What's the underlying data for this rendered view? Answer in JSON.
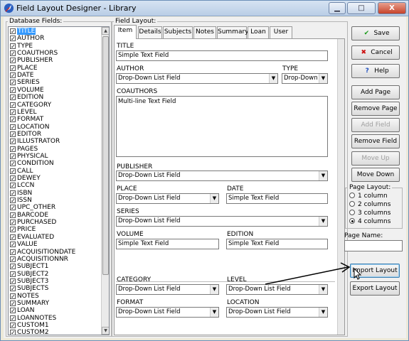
{
  "window": {
    "title": "Field Layout Designer - Library",
    "min_label": "▁",
    "max_label": "□",
    "close_label": "X"
  },
  "db_fields": {
    "label": "Database Fields:",
    "items": [
      "TITLE",
      "AUTHOR",
      "TYPE",
      "COAUTHORS",
      "PUBLISHER",
      "PLACE",
      "DATE",
      "SERIES",
      "VOLUME",
      "EDITION",
      "CATEGORY",
      "LEVEL",
      "FORMAT",
      "LOCATION",
      "EDITOR",
      "ILLUSTRATOR",
      "PAGES",
      "PHYSICAL",
      "CONDITION",
      "CALL",
      "DEWEY",
      "LCCN",
      "ISBN",
      "ISSN",
      "UPC_OTHER",
      "BARCODE",
      "PURCHASED",
      "PRICE",
      "EVALUATED",
      "VALUE",
      "ACQUISITIONDATE",
      "ACQUISITIONNR",
      "SUBJECT1",
      "SUBJECT2",
      "SUBJECT3",
      "SUBJECTS",
      "NOTES",
      "SUMMARY",
      "LOAN",
      "LOANNOTES",
      "CUSTOM1",
      "CUSTOM2"
    ],
    "selected": "TITLE",
    "check": "✓"
  },
  "layout": {
    "label": "Field Layout:",
    "tabs": [
      "Item",
      "Details",
      "Subjects",
      "Notes",
      "Summary",
      "Loan",
      "User"
    ],
    "fields": {
      "title": {
        "label": "TITLE",
        "value": "Simple Text Field"
      },
      "author": {
        "label": "AUTHOR",
        "value": "Drop-Down List Field"
      },
      "type": {
        "label": "TYPE",
        "value": "Drop-Down L"
      },
      "coauthors": {
        "label": "COAUTHORS",
        "value": "Multi-line Text Field"
      },
      "publisher": {
        "label": "PUBLISHER",
        "value": "Drop-Down List Field"
      },
      "place": {
        "label": "PLACE",
        "value": "Drop-Down List Field"
      },
      "date": {
        "label": "DATE",
        "value": "Simple Text Field"
      },
      "series": {
        "label": "SERIES",
        "value": "Drop-Down List Field"
      },
      "volume": {
        "label": "VOLUME",
        "value": "Simple Text Field"
      },
      "edition": {
        "label": "EDITION",
        "value": "Simple Text Field"
      },
      "category": {
        "label": "CATEGORY",
        "value": "Drop-Down List Field"
      },
      "level": {
        "label": "LEVEL",
        "value": "Drop-Down List Field"
      },
      "format": {
        "label": "FORMAT",
        "value": "Drop-Down List Field"
      },
      "location": {
        "label": "LOCATION",
        "value": "Drop-Down List Field"
      }
    }
  },
  "buttons": {
    "save": "Save",
    "cancel": "Cancel",
    "help": "Help",
    "add_page": "Add Page",
    "remove_page": "Remove Page",
    "add_field": "Add Field",
    "remove_field": "Remove Field",
    "move_up": "Move Up",
    "move_down": "Move Down",
    "import_layout": "Import Layout",
    "export_layout": "Export Layout"
  },
  "page_layout": {
    "label": "Page Layout:",
    "options": [
      "1 column",
      "2 columns",
      "3 columns",
      "4 columns"
    ],
    "selected": "4 columns"
  },
  "page_name": {
    "label": "Page Name:",
    "value": ""
  },
  "colors": {
    "selection": "#3399ff",
    "save_icon": "#1a9a1a",
    "cancel_icon": "#cc1111",
    "help_icon": "#1f4fbf",
    "annotation_arrow": "#000000"
  }
}
